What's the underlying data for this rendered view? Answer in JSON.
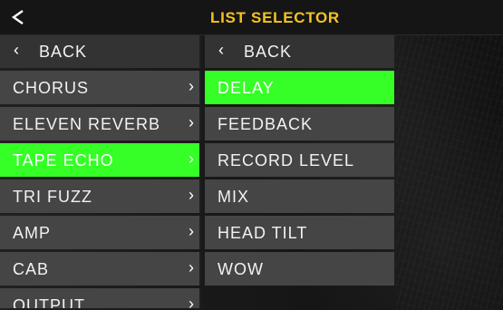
{
  "header": {
    "title": "LIST SELECTOR",
    "back_icon": "left-triangle-icon"
  },
  "left_list": {
    "back_label": "BACK",
    "items": [
      {
        "label": "CHORUS",
        "selected": false
      },
      {
        "label": "ELEVEN REVERB",
        "selected": false
      },
      {
        "label": "TAPE ECHO",
        "selected": true
      },
      {
        "label": "TRI FUZZ",
        "selected": false
      },
      {
        "label": "AMP",
        "selected": false
      },
      {
        "label": "CAB",
        "selected": false
      },
      {
        "label": "OUTPUT",
        "selected": false
      }
    ]
  },
  "right_list": {
    "back_label": "BACK",
    "items": [
      {
        "label": "DELAY",
        "selected": true
      },
      {
        "label": "FEEDBACK",
        "selected": false
      },
      {
        "label": "RECORD LEVEL",
        "selected": false
      },
      {
        "label": "MIX",
        "selected": false
      },
      {
        "label": "HEAD TILT",
        "selected": false
      },
      {
        "label": "WOW",
        "selected": false
      }
    ]
  },
  "colors": {
    "title": "#f5c320",
    "selected": "#35ff26",
    "row": "#454545",
    "back_row": "#333333"
  }
}
